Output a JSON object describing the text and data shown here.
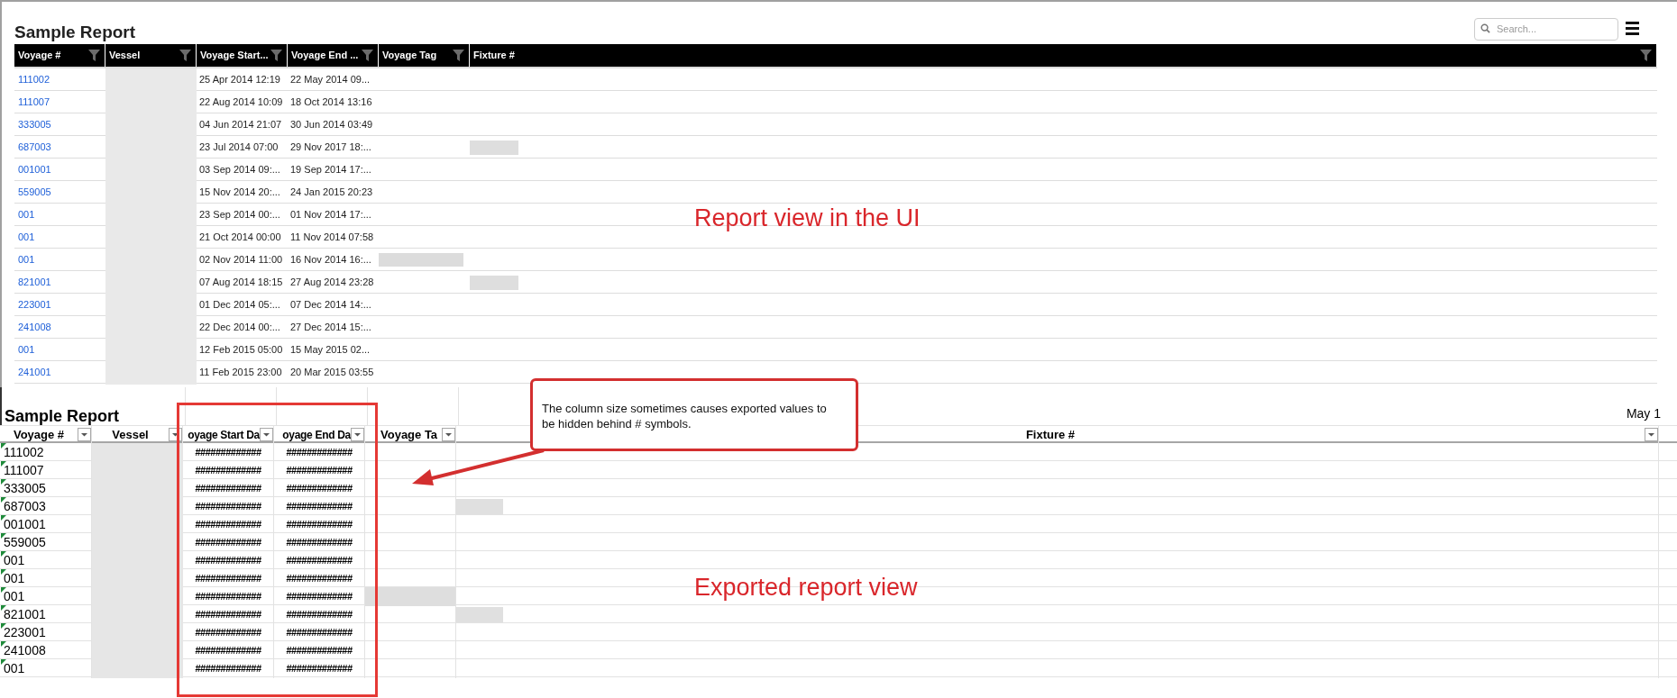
{
  "report_ui": {
    "title": "Sample Report",
    "search": {
      "placeholder": "Search..."
    },
    "columns": [
      {
        "label": "Voyage #"
      },
      {
        "label": "Vessel"
      },
      {
        "label": "Voyage Start..."
      },
      {
        "label": "Voyage End ..."
      },
      {
        "label": "Voyage Tag"
      },
      {
        "label": "Fixture #"
      }
    ],
    "rows": [
      {
        "voyage": "111002",
        "start": "25 Apr 2014 12:19",
        "end": "22 May 2014 09...",
        "tag_redacted": false,
        "fixture_redacted": false
      },
      {
        "voyage": "111007",
        "start": "22 Aug 2014 10:09",
        "end": "18 Oct 2014 13:16",
        "tag_redacted": false,
        "fixture_redacted": false
      },
      {
        "voyage": "333005",
        "start": "04 Jun 2014 21:07",
        "end": "30 Jun 2014 03:49",
        "tag_redacted": false,
        "fixture_redacted": false
      },
      {
        "voyage": "687003",
        "start": "23 Jul 2014 07:00",
        "end": "29 Nov 2017 18:...",
        "tag_redacted": false,
        "fixture_redacted": true
      },
      {
        "voyage": "001001",
        "start": "03 Sep 2014 09:...",
        "end": "19 Sep 2014 17:...",
        "tag_redacted": false,
        "fixture_redacted": false
      },
      {
        "voyage": "559005",
        "start": "15 Nov 2014 20:...",
        "end": "24 Jan 2015 20:23",
        "tag_redacted": false,
        "fixture_redacted": false
      },
      {
        "voyage": "001",
        "start": "23 Sep 2014 00:...",
        "end": "01 Nov 2014 17:...",
        "tag_redacted": false,
        "fixture_redacted": false
      },
      {
        "voyage": "001",
        "start": "21 Oct 2014 00:00",
        "end": "11 Nov 2014 07:58",
        "tag_redacted": false,
        "fixture_redacted": false
      },
      {
        "voyage": "001",
        "start": "02 Nov 2014 11:00",
        "end": "16 Nov 2014 16:...",
        "tag_redacted": true,
        "fixture_redacted": false
      },
      {
        "voyage": "821001",
        "start": "07 Aug 2014 18:15",
        "end": "27 Aug 2014 23:28",
        "tag_redacted": false,
        "fixture_redacted": true
      },
      {
        "voyage": "223001",
        "start": "01 Dec 2014 05:...",
        "end": "07 Dec 2014 14:...",
        "tag_redacted": false,
        "fixture_redacted": false
      },
      {
        "voyage": "241008",
        "start": "22 Dec 2014 00:...",
        "end": "27 Dec 2014 15:...",
        "tag_redacted": false,
        "fixture_redacted": false
      },
      {
        "voyage": "001",
        "start": "12 Feb 2015 05:00",
        "end": "15 May 2015 02...",
        "tag_redacted": false,
        "fixture_redacted": false
      },
      {
        "voyage": "241001",
        "start": "11 Feb 2015 23:00",
        "end": "20 Mar 2015 03:55",
        "tag_redacted": false,
        "fixture_redacted": false
      }
    ]
  },
  "annotation_ui": "Report view in the UI",
  "callout": "The column size sometimes causes exported values to be hidden behind # symbols.",
  "export": {
    "title": "Sample Report",
    "date": "May 1",
    "columns": [
      {
        "label": "Voyage #"
      },
      {
        "label": "Vessel"
      },
      {
        "label": "oyage Start Da"
      },
      {
        "label": "oyage End Da"
      },
      {
        "label": "Voyage Ta"
      },
      {
        "label": "Fixture #"
      }
    ],
    "rows": [
      {
        "voyage": "111002",
        "start": "#############",
        "end": "#############",
        "tag_redacted": false,
        "fixture_redacted": false
      },
      {
        "voyage": "111007",
        "start": "#############",
        "end": "#############",
        "tag_redacted": false,
        "fixture_redacted": false
      },
      {
        "voyage": "333005",
        "start": "#############",
        "end": "#############",
        "tag_redacted": false,
        "fixture_redacted": false
      },
      {
        "voyage": "687003",
        "start": "#############",
        "end": "#############",
        "tag_redacted": false,
        "fixture_redacted": true
      },
      {
        "voyage": "001001",
        "start": "#############",
        "end": "#############",
        "tag_redacted": false,
        "fixture_redacted": false
      },
      {
        "voyage": "559005",
        "start": "#############",
        "end": "#############",
        "tag_redacted": false,
        "fixture_redacted": false
      },
      {
        "voyage": "001",
        "start": "#############",
        "end": "#############",
        "tag_redacted": false,
        "fixture_redacted": false
      },
      {
        "voyage": "001",
        "start": "#############",
        "end": "#############",
        "tag_redacted": false,
        "fixture_redacted": false
      },
      {
        "voyage": "001",
        "start": "#############",
        "end": "#############",
        "tag_redacted": true,
        "fixture_redacted": false
      },
      {
        "voyage": "821001",
        "start": "#############",
        "end": "#############",
        "tag_redacted": false,
        "fixture_redacted": true
      },
      {
        "voyage": "223001",
        "start": "#############",
        "end": "#############",
        "tag_redacted": false,
        "fixture_redacted": false
      },
      {
        "voyage": "241008",
        "start": "#############",
        "end": "#############",
        "tag_redacted": false,
        "fixture_redacted": false
      },
      {
        "voyage": "001",
        "start": "#############",
        "end": "#############",
        "tag_redacted": false,
        "fixture_redacted": false
      }
    ]
  },
  "annotation_export": "Exported report view"
}
